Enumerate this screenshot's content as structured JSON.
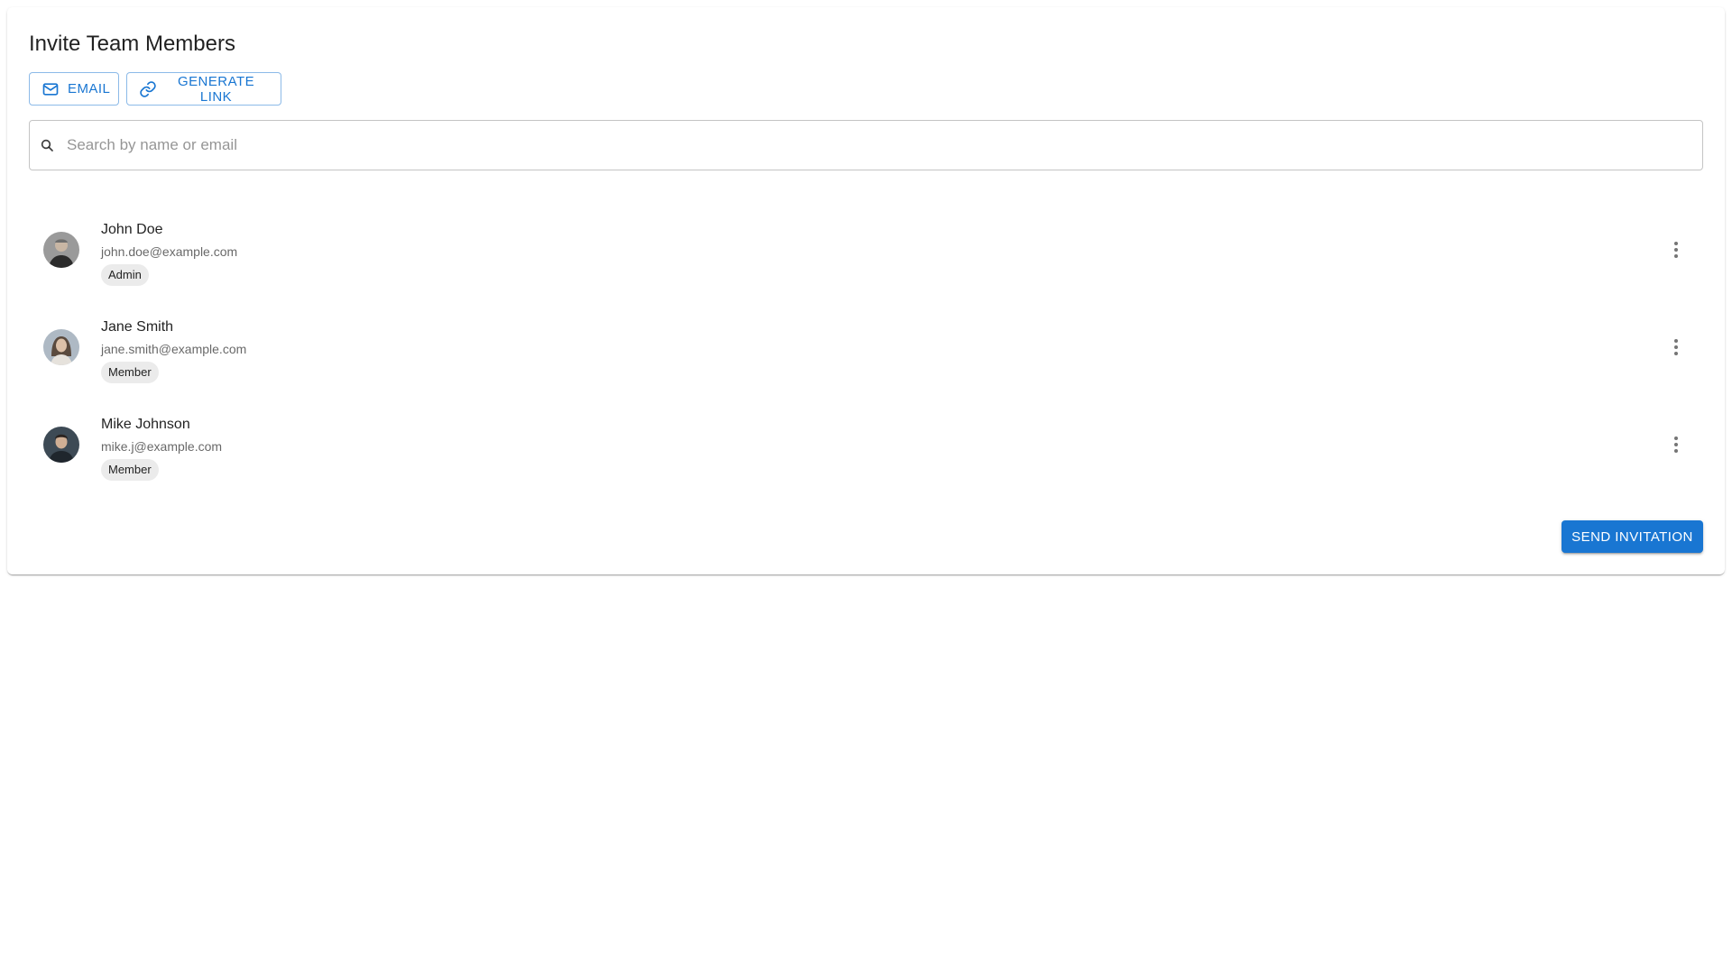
{
  "dialog": {
    "title": "Invite Team Members"
  },
  "tabs": {
    "email_label": "EMAIL",
    "email_icon": "mail-icon",
    "link_label": "GENERATE LINK",
    "link_icon": "link-icon"
  },
  "search": {
    "placeholder": "Search by name or email",
    "value": "",
    "icon": "search-icon"
  },
  "members": [
    {
      "name": "John Doe",
      "email": "john.doe@example.com",
      "role": "Admin",
      "avatar": "user-photo"
    },
    {
      "name": "Jane Smith",
      "email": "jane.smith@example.com",
      "role": "Member",
      "avatar": "user-photo"
    },
    {
      "name": "Mike Johnson",
      "email": "mike.j@example.com",
      "role": "Member",
      "avatar": "user-photo"
    }
  ],
  "actions": {
    "send_label": "SEND INVITATION",
    "more_icon": "more-vertical-icon"
  },
  "colors": {
    "primary": "#1976d2",
    "chip_bg": "#ebebeb",
    "text_primary": "#212121",
    "text_secondary": "#666666"
  }
}
